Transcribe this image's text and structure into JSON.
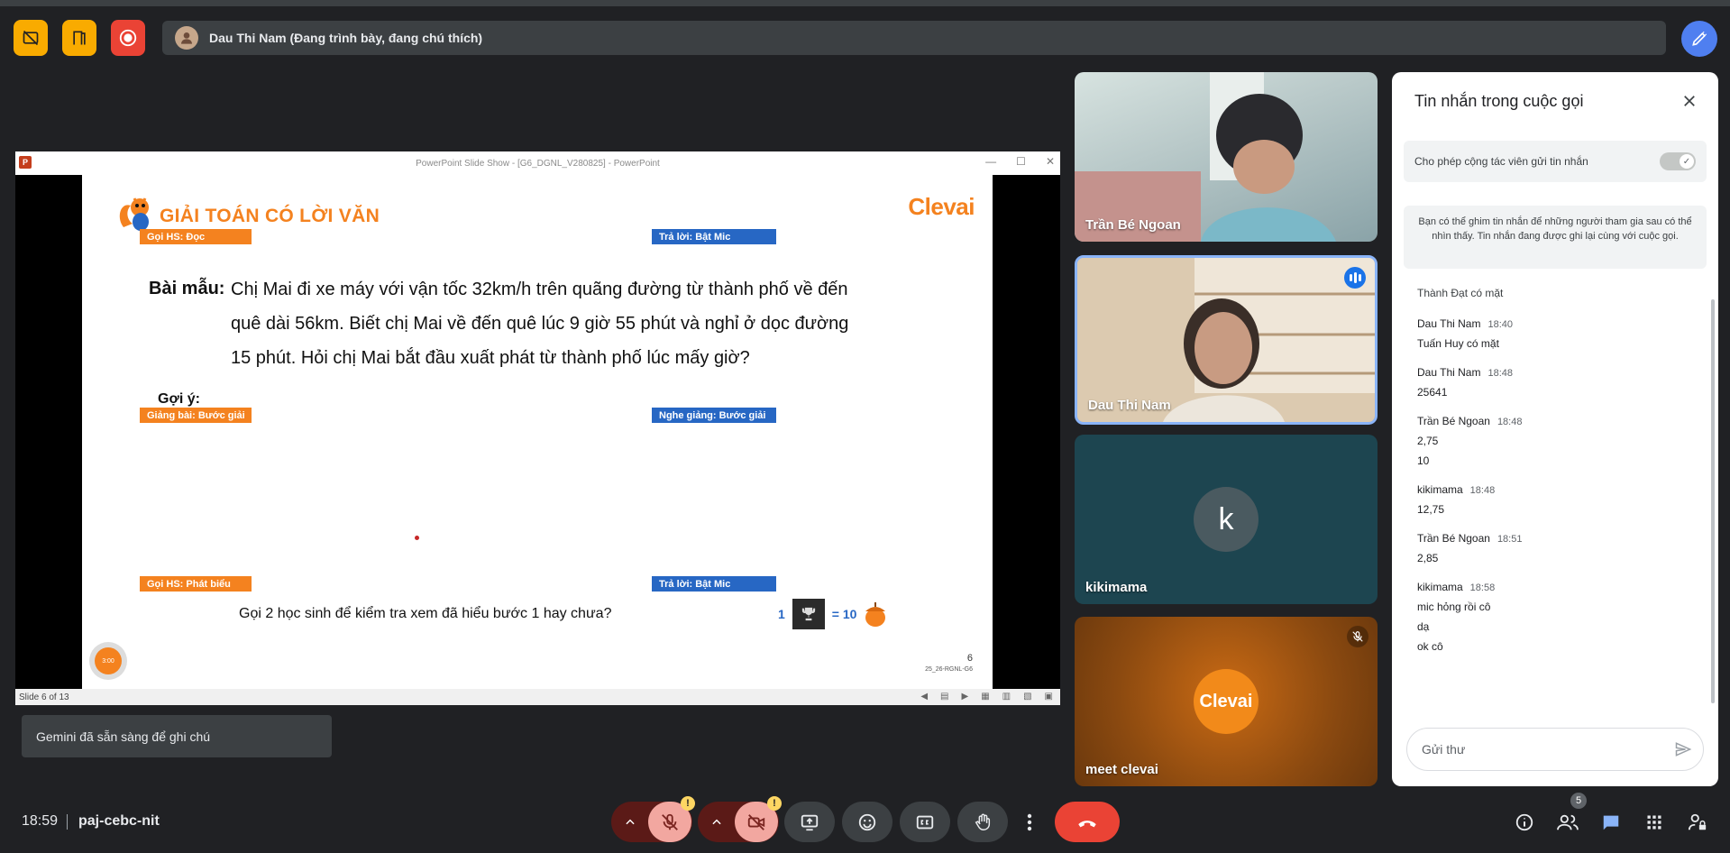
{
  "presenter_bar": {
    "text": "Dau Thi Nam (Đang trình bày, đang chú thích)"
  },
  "ppt": {
    "window_title": "PowerPoint Slide Show - [G6_DGNL_V280825] - PowerPoint",
    "logo_letter": "P",
    "status": "Slide 6 of 13"
  },
  "slide": {
    "title": "GIẢI TOÁN CÓ LỜI VĂN",
    "brand": "Clevai",
    "tags": {
      "goi_doc": "Gọi HS: Đọc",
      "tra_loi_1": "Trả lời: Bật Mic",
      "giang_bai": "Giảng bài: Bước giải",
      "nghe_giang": "Nghe giảng: Bước giải",
      "goi_phat_bieu": "Gọi HS: Phát biểu",
      "tra_loi_2": "Trả lời: Bật Mic"
    },
    "sample_label": "Bài mẫu:",
    "problem_lines": [
      "Chị Mai đi xe máy với vận tốc 32km/h trên quãng đường từ thành phố về đến",
      "quê dài 56km. Biết chị Mai về đến quê lúc 9 giờ 55 phút và nghỉ ở dọc đường",
      "15 phút. Hỏi chị Mai bắt đầu xuất phát từ thành phố lúc mấy giờ?"
    ],
    "hint_label": "Gợi ý:",
    "question": "Gọi 2 học sinh để kiểm tra xem đã hiểu bước 1 hay chưa?",
    "score_count": "1",
    "score_value": "= 10",
    "page_number": "6",
    "page_code": "25_26-RGNL-G6",
    "timer": "3:00"
  },
  "gemini_toast": "Gemini đã sẵn sàng để ghi chú",
  "tiles": [
    {
      "name": "Trần Bé Ngoan"
    },
    {
      "name": "Dau Thi Nam"
    },
    {
      "name": "kikimama",
      "initial": "k"
    },
    {
      "name": "meet clevai",
      "avatar_text": "Clevai"
    }
  ],
  "chat": {
    "title": "Tin nhắn trong cuộc gọi",
    "toggle_label": "Cho phép cộng tác viên gửi tin nhắn",
    "pin_note": "Bạn có thể ghim tin nhắn để những người tham gia sau có thể nhìn thấy. Tin nhắn đang được ghi lại cùng với cuộc gọi.",
    "system_message": "Thành Đạt có mặt",
    "messages": [
      {
        "sender": "Dau Thi Nam",
        "time": "18:40",
        "lines": [
          "Tuấn Huy có mặt"
        ]
      },
      {
        "sender": "Dau Thi Nam",
        "time": "18:48",
        "lines": [
          "25641"
        ]
      },
      {
        "sender": "Trần Bé Ngoan",
        "time": "18:48",
        "lines": [
          "2,75",
          "10"
        ]
      },
      {
        "sender": "kikimama",
        "time": "18:48",
        "lines": [
          "12,75"
        ]
      },
      {
        "sender": "Trần Bé Ngoan",
        "time": "18:51",
        "lines": [
          "2,85"
        ]
      },
      {
        "sender": "kikimama",
        "time": "18:58",
        "lines": [
          "mic hỏng rồi cô",
          "dạ",
          "ok cô"
        ]
      }
    ],
    "input_placeholder": "Gửi thư"
  },
  "bottom": {
    "time": "18:59",
    "meeting_code": "paj-cebc-nit",
    "people_count": "5",
    "warn_symbol": "!"
  },
  "colors": {
    "accent_orange": "#f4821f",
    "slide_blue": "#2767c4",
    "end_call": "#ea4335",
    "meet_blue": "#8ab4f8"
  }
}
